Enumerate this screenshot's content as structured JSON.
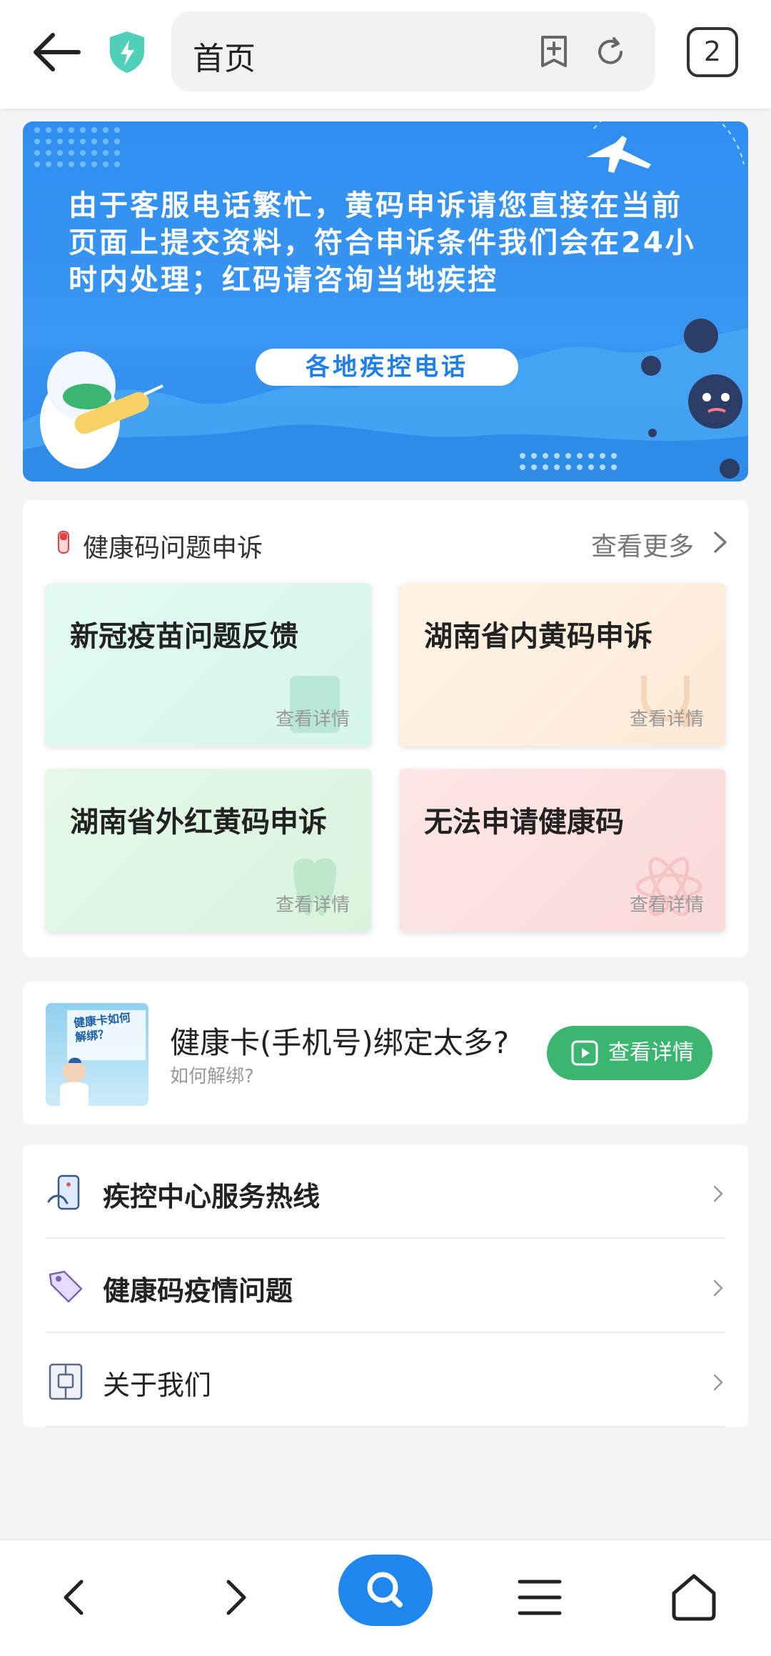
{
  "browser": {
    "url_title": "首页",
    "tab_count": "2"
  },
  "banner": {
    "notice": "由于客服电话繁忙，黄码申诉请您直接在当前页面上提交资料，符合申诉条件我们会在24小时内处理；红码请咨询当地疾控",
    "button_label": "各地疾控电话"
  },
  "health_code_section": {
    "title": "健康码问题申诉",
    "more_label": "查看更多",
    "cards": [
      {
        "title": "新冠疫苗问题反馈",
        "detail": "查看详情"
      },
      {
        "title": "湖南省内黄码申诉",
        "detail": "查看详情"
      },
      {
        "title": "湖南省外红黄码申诉",
        "detail": "查看详情"
      },
      {
        "title": "无法申请健康码",
        "detail": "查看详情"
      }
    ]
  },
  "promo": {
    "thumb_text": "健康卡如何解绑？",
    "title": "健康卡(手机号)绑定太多?",
    "subtitle": "如何解绑?",
    "button_label": "查看详情"
  },
  "list": {
    "items": [
      {
        "label": "疾控中心服务热线",
        "icon": "hotline-icon"
      },
      {
        "label": "健康码疫情问题",
        "icon": "tag-icon"
      },
      {
        "label": "关于我们",
        "icon": "about-icon"
      }
    ]
  },
  "colors": {
    "accent_blue": "#1f86ee",
    "banner_blue": "#3a96f2",
    "promo_green": "#3bb56f"
  }
}
